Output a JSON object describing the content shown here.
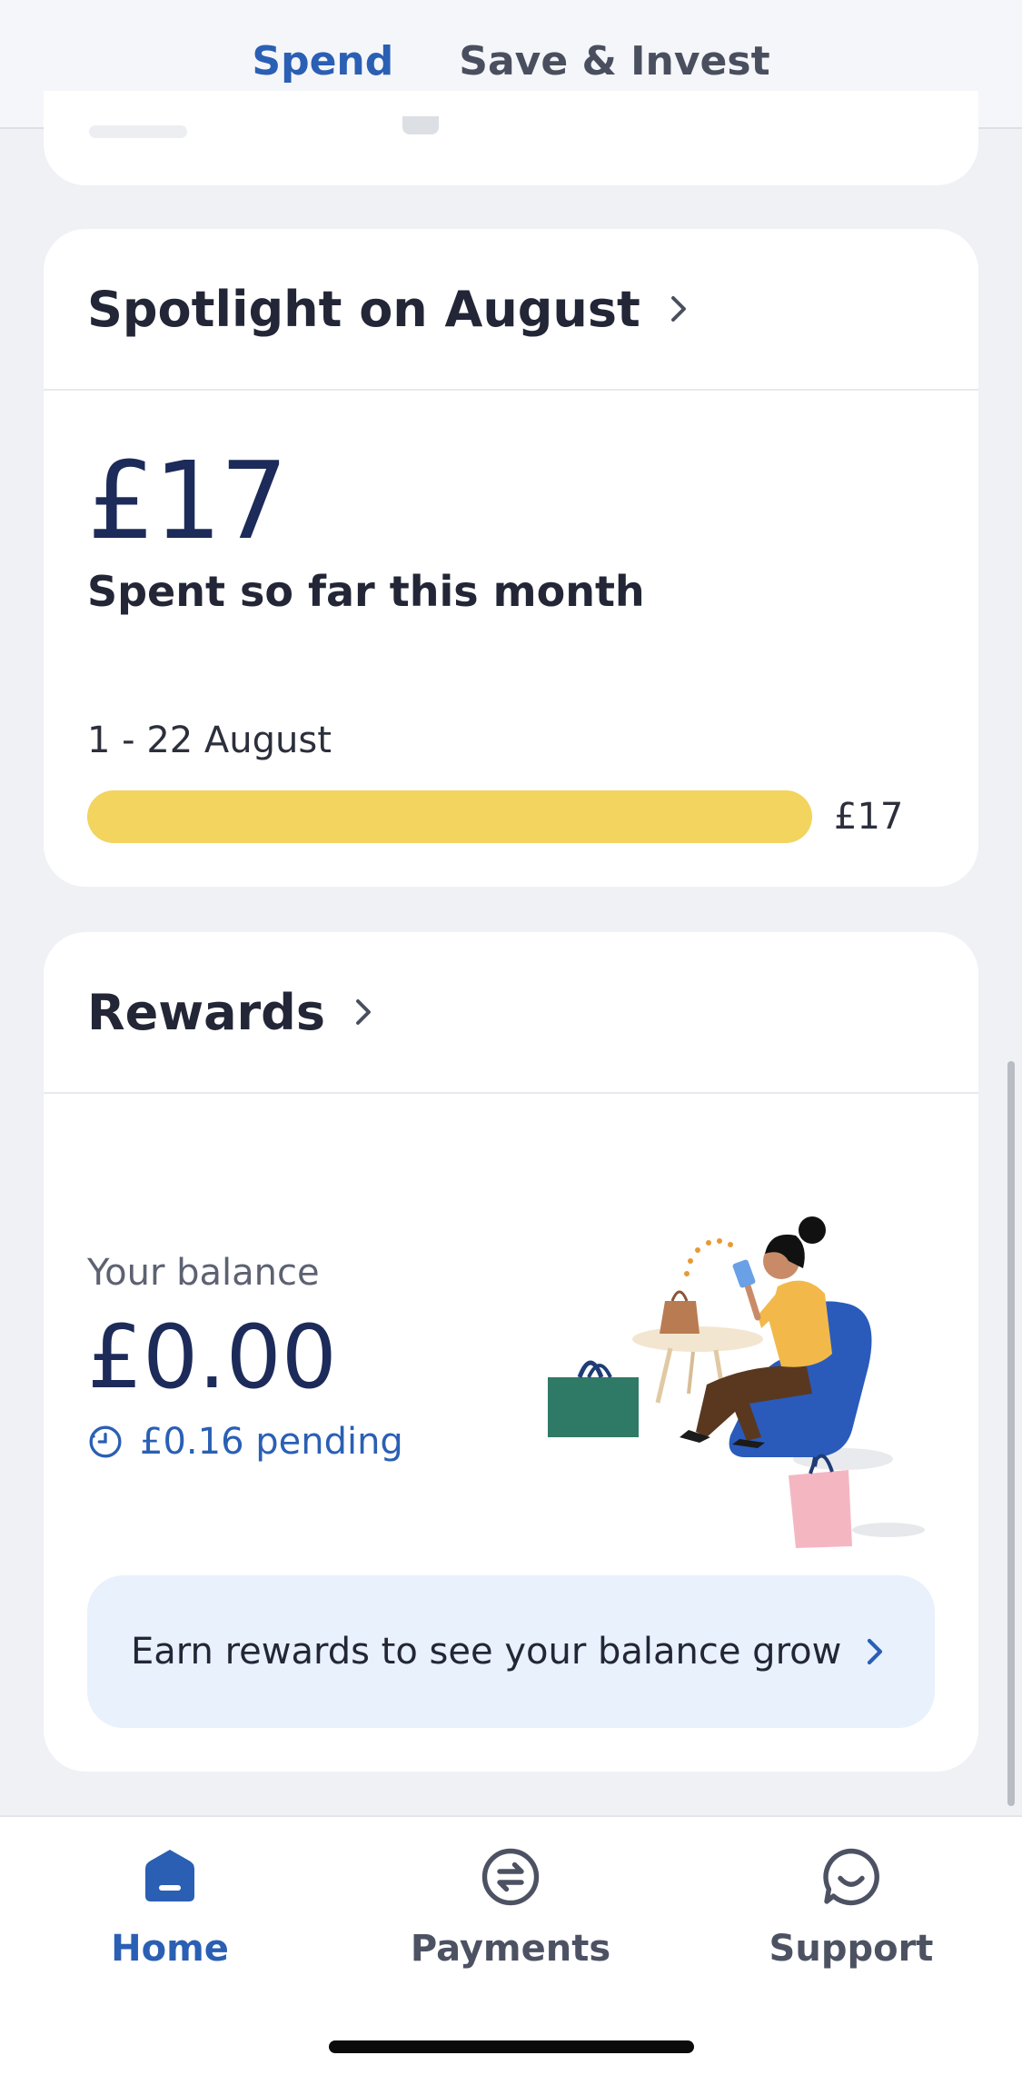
{
  "top_tabs": [
    {
      "label": "Spend",
      "active": true
    },
    {
      "label": "Save & Invest",
      "active": false
    }
  ],
  "spotlight": {
    "title": "Spotlight on August",
    "amount": "£17",
    "subtitle": "Spent so far this month",
    "range": "1 - 22 August",
    "bar_label": "£17",
    "progress_fraction": 1.0
  },
  "rewards": {
    "title": "Rewards",
    "balance_label": "Your balance",
    "balance": "£0.00",
    "pending": "£0.16 pending",
    "cta": "Earn rewards to see your balance grow"
  },
  "bottom_nav": [
    {
      "label": "Home",
      "icon": "home-icon",
      "active": true
    },
    {
      "label": "Payments",
      "icon": "payments-icon",
      "active": false
    },
    {
      "label": "Support",
      "icon": "support-icon",
      "active": false
    }
  ],
  "colors": {
    "accent": "#2a5fb4",
    "bar": "#f2d45e",
    "amount": "#1c2b59",
    "background": "#eff1f5"
  }
}
